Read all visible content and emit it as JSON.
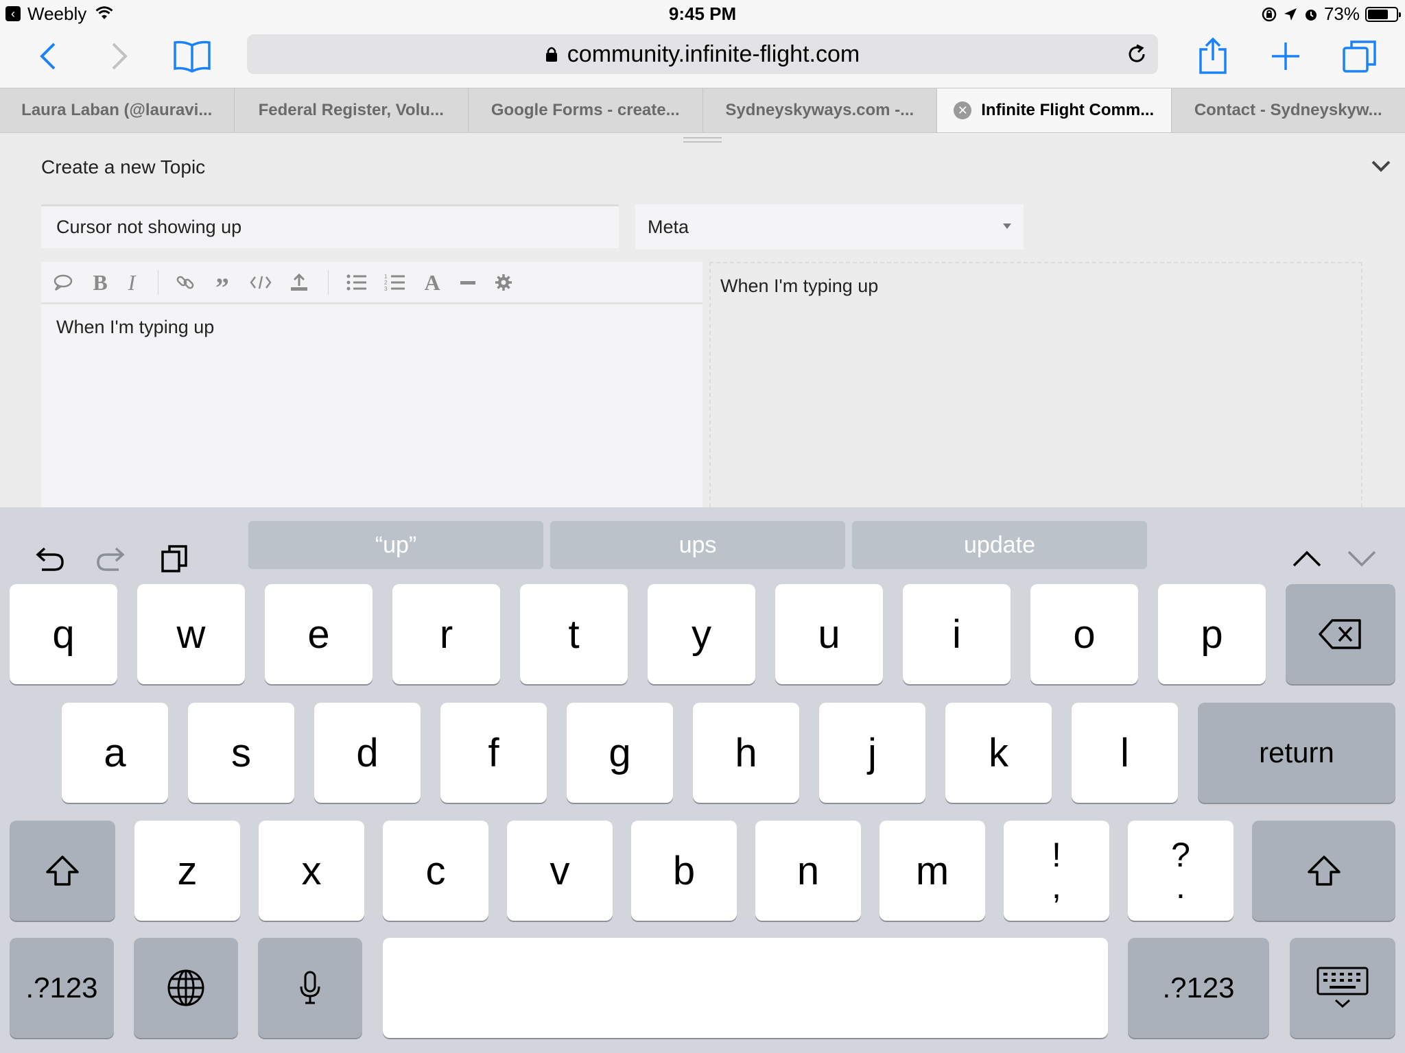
{
  "status_bar": {
    "app": "Weebly",
    "time": "9:45 PM",
    "battery_text": "73%",
    "battery_level": 0.73
  },
  "browser": {
    "url": "community.infinite-flight.com",
    "tabs": [
      {
        "label": "Laura Laban (@lauravi...",
        "active": false
      },
      {
        "label": "Federal Register, Volu...",
        "active": false
      },
      {
        "label": "Google Forms - create...",
        "active": false
      },
      {
        "label": "Sydneyskyways.com -...",
        "active": false
      },
      {
        "label": "Infinite Flight Comm...",
        "active": true
      },
      {
        "label": "Contact - Sydneyskyw...",
        "active": false
      }
    ]
  },
  "composer": {
    "heading": "Create a new Topic",
    "title_value": "Cursor not showing up",
    "category": "Meta",
    "body_text": "When I'm typing up",
    "preview_text": "When I'm typing up"
  },
  "keyboard": {
    "suggestions": [
      "“up”",
      "ups",
      "update"
    ],
    "row1": [
      "q",
      "w",
      "e",
      "r",
      "t",
      "y",
      "u",
      "i",
      "o",
      "p"
    ],
    "row2": [
      "a",
      "s",
      "d",
      "f",
      "g",
      "h",
      "j",
      "k",
      "l"
    ],
    "row3": [
      "z",
      "x",
      "c",
      "v",
      "b",
      "n",
      "m"
    ],
    "punct1": {
      "top": "!",
      "bottom": ","
    },
    "punct2": {
      "top": "?",
      "bottom": "."
    },
    "return_label": "return",
    "numbers_label": ".?123"
  },
  "colors": {
    "ios_blue": "#1a82fb",
    "keyboard_bg": "#d2d5db",
    "key_dark": "#abb1ba"
  }
}
